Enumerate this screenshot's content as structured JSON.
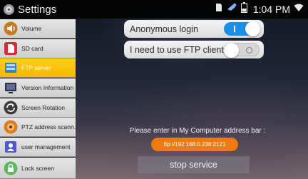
{
  "statusbar": {
    "app_icon": "gear-icon",
    "title": "Settings",
    "icons": [
      "sim-card-icon",
      "usb-icon",
      "battery-icon"
    ],
    "time": "1:04 PM",
    "wifi_icon": "wifi-icon"
  },
  "sidebar": {
    "items": [
      {
        "label": "Volume",
        "icon": "speaker-icon"
      },
      {
        "label": "SD card",
        "icon": "sd-card-icon"
      },
      {
        "label": "FTP server",
        "icon": "server-icon"
      },
      {
        "label": "Version Information",
        "icon": "monitor-icon"
      },
      {
        "label": "Screen Rotation",
        "icon": "rotation-icon"
      },
      {
        "label": "PTZ address scann...",
        "icon": "ptz-camera-icon"
      },
      {
        "label": "user management",
        "icon": "user-icon"
      },
      {
        "label": "Lock screen",
        "icon": "lock-icon"
      }
    ],
    "active_index": 2
  },
  "main": {
    "anonymous_login": {
      "label": "Anonymous login",
      "state": "on"
    },
    "use_ftp_client": {
      "label": "I need to use FTP client",
      "state": "off"
    },
    "info_text": "Please enter in  My Computer address bar :",
    "ftp_address": "ftp://192.168.0.238:2121",
    "stop_label": "stop service"
  },
  "colors": {
    "accent": "#f5b800",
    "toggle_on": "#1a8fe8",
    "ftp_pill": "#f07a12"
  }
}
